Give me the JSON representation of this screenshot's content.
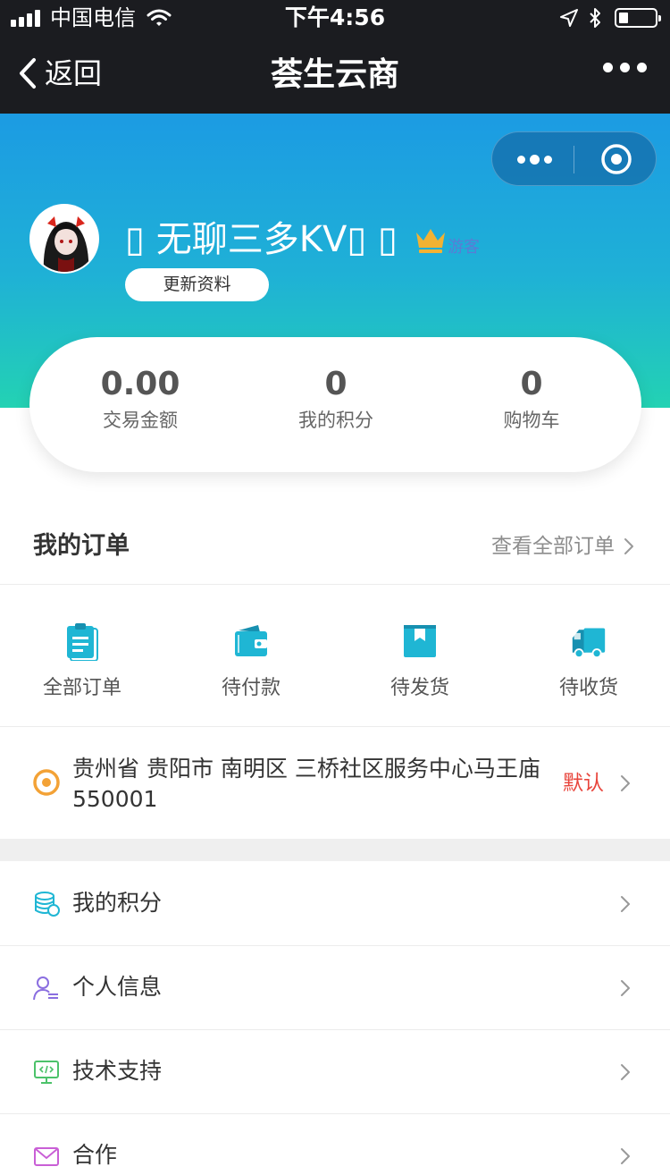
{
  "status_bar": {
    "carrier": "中国电信",
    "time": "下午4:56"
  },
  "nav": {
    "back_label": "返回",
    "title": "荟生云商"
  },
  "profile": {
    "username": "▯ 无聊三多KV▯ ▯",
    "role": "游客",
    "update_label": "更新资料"
  },
  "stats": [
    {
      "value": "0.00",
      "label": "交易金额"
    },
    {
      "value": "0",
      "label": "我的积分"
    },
    {
      "value": "0",
      "label": "购物车"
    }
  ],
  "orders": {
    "title": "我的订单",
    "view_all": "查看全部订单",
    "items": [
      {
        "label": "全部订单",
        "icon": "clipboard-icon"
      },
      {
        "label": "待付款",
        "icon": "wallet-icon"
      },
      {
        "label": "待发货",
        "icon": "package-icon"
      },
      {
        "label": "待收货",
        "icon": "truck-icon"
      }
    ]
  },
  "address": {
    "text": "贵州省 贵阳市 南明区 三桥社区服务中心马王庙 550001",
    "default_label": "默认"
  },
  "menu": [
    {
      "label": "我的积分",
      "icon": "coins-icon"
    },
    {
      "label": "个人信息",
      "icon": "user-info-icon"
    },
    {
      "label": "技术支持",
      "icon": "code-monitor-icon"
    },
    {
      "label": "合作",
      "icon": "mail-icon"
    }
  ],
  "colors": {
    "gradient_top": "#1c9be3",
    "gradient_bottom": "#23d2b3",
    "nav_bg": "#1b1c20",
    "accent_red": "#e8453c",
    "crown": "#f2b233",
    "icon_teal": "#1fb6d4"
  }
}
